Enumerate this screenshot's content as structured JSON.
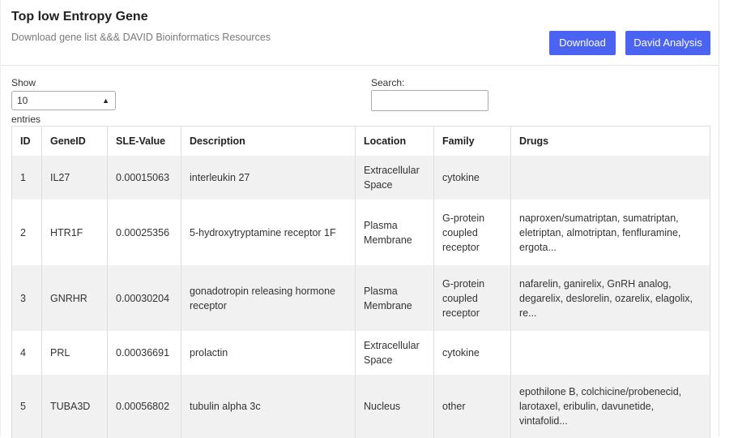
{
  "card": {
    "title": "Top low Entropy Gene",
    "subtitle": "Download gene list &&& DAVID Bioinformatics Resources",
    "download_label": "Download",
    "david_label": "David Analysis"
  },
  "controls": {
    "show_label": "Show",
    "page_size": "10",
    "entries_label": "entries",
    "search_label": "Search:",
    "search_value": ""
  },
  "table": {
    "columns": [
      "ID",
      "GeneID",
      "SLE-Value",
      "Description",
      "Location",
      "Family",
      "Drugs"
    ],
    "rows": [
      {
        "id": "1",
        "gene": "IL27",
        "value": "0.00015063",
        "description": "interleukin 27",
        "location": "Extracellular Space",
        "family": "cytokine",
        "drugs": ""
      },
      {
        "id": "2",
        "gene": "HTR1F",
        "value": "0.00025356",
        "description": "5-hydroxytryptamine receptor 1F",
        "location": "Plasma Membrane",
        "family": "G-protein coupled receptor",
        "drugs": "naproxen/sumatriptan, sumatriptan, eletriptan, almotriptan, fenfluramine, ergota..."
      },
      {
        "id": "3",
        "gene": "GNRHR",
        "value": "0.00030204",
        "description": "gonadotropin releasing hormone receptor",
        "location": "Plasma Membrane",
        "family": "G-protein coupled receptor",
        "drugs": "nafarelin, ganirelix, GnRH analog, degarelix, deslorelin, ozarelix, elagolix, re..."
      },
      {
        "id": "4",
        "gene": "PRL",
        "value": "0.00036691",
        "description": "prolactin",
        "location": "Extracellular Space",
        "family": "cytokine",
        "drugs": ""
      },
      {
        "id": "5",
        "gene": "TUBA3D",
        "value": "0.00056802",
        "description": "tubulin alpha 3c",
        "location": "Nucleus",
        "family": "other",
        "drugs": "epothilone B, colchicine/probenecid, larotaxel, eribulin, davunetide, vintafolid..."
      }
    ]
  }
}
